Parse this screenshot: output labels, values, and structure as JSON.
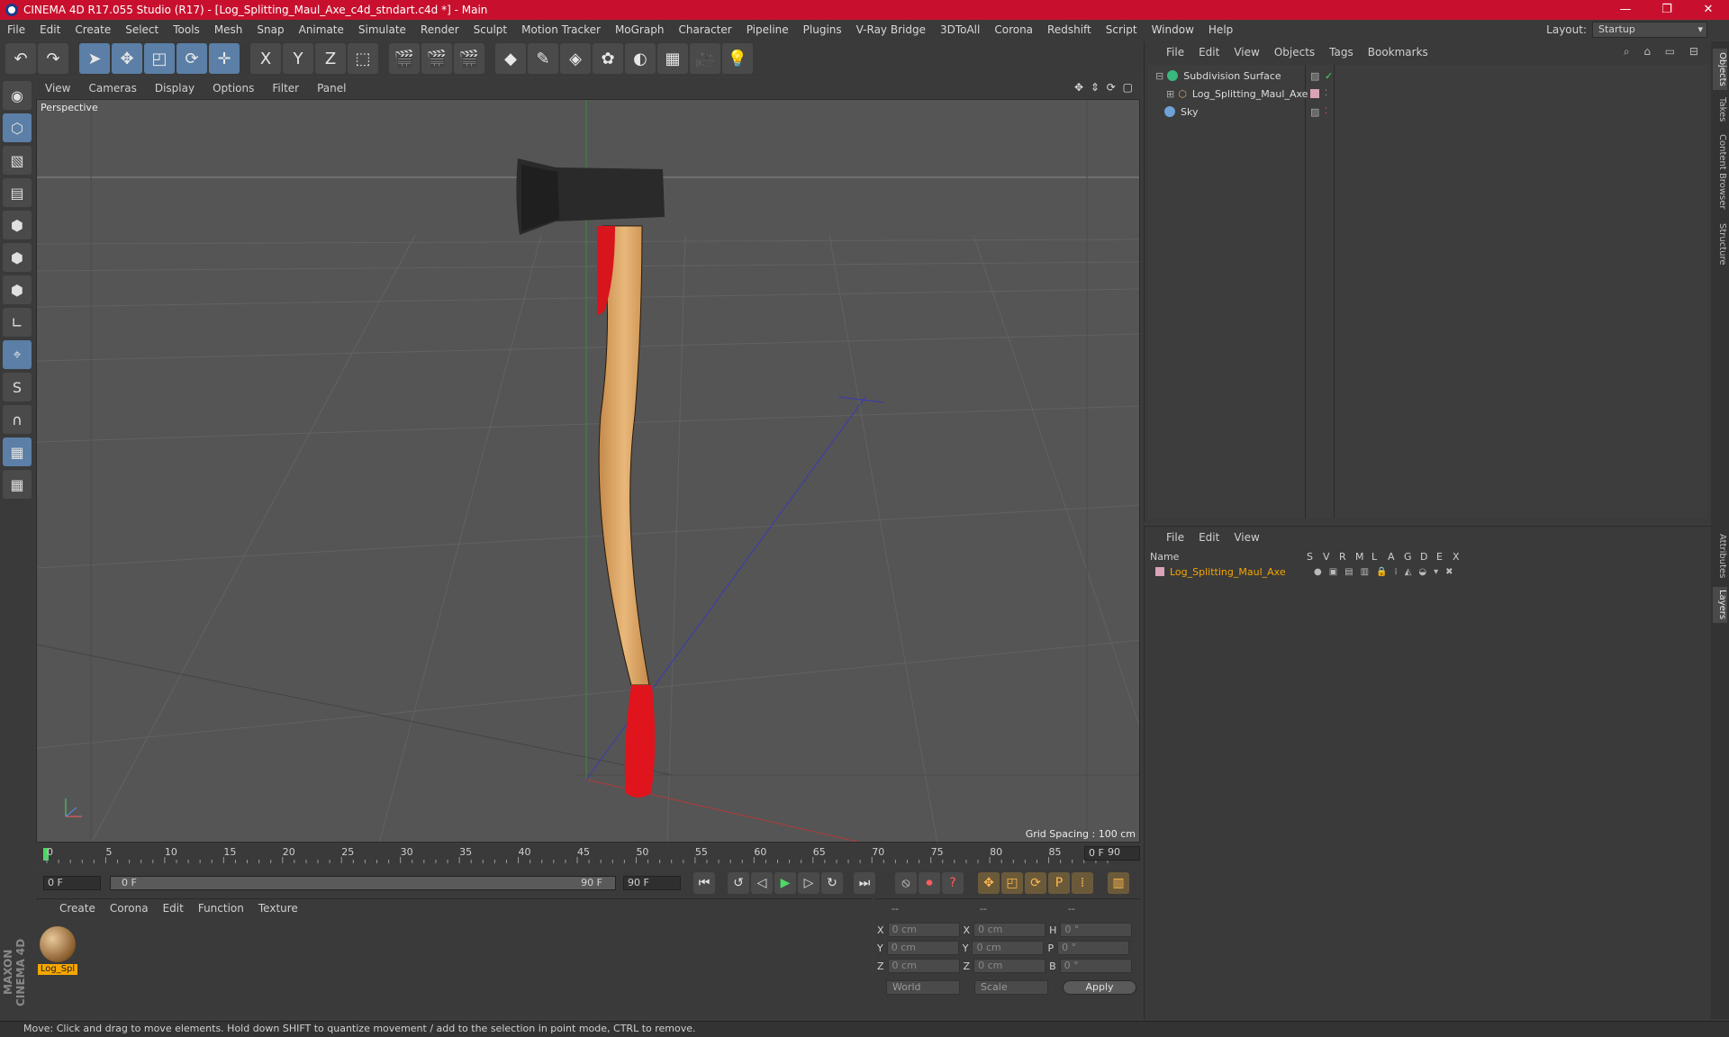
{
  "window": {
    "title": "CINEMA 4D R17.055 Studio (R17) - [Log_Splitting_Maul_Axe_c4d_stndart.c4d *] - Main",
    "controls": [
      "—",
      "❐",
      "✕"
    ]
  },
  "menubar": {
    "items": [
      "File",
      "Edit",
      "Create",
      "Select",
      "Tools",
      "Mesh",
      "Snap",
      "Animate",
      "Simulate",
      "Render",
      "Sculpt",
      "Motion Tracker",
      "MoGraph",
      "Character",
      "Pipeline",
      "Plugins",
      "V-Ray Bridge",
      "3DToAll",
      "Corona",
      "Redshift",
      "Script",
      "Window",
      "Help"
    ],
    "layout_label": "Layout:",
    "layout_value": "Startup"
  },
  "toolbar": {
    "buttons": [
      {
        "name": "undo-icon",
        "glyph": "↶"
      },
      {
        "name": "redo-icon",
        "glyph": "↷"
      },
      {
        "name": "select-arrow-icon",
        "glyph": "➤"
      },
      {
        "name": "move-icon",
        "glyph": "✥"
      },
      {
        "name": "scale-icon",
        "glyph": "◰"
      },
      {
        "name": "rotate-icon",
        "glyph": "⟳"
      },
      {
        "name": "transform-icon",
        "glyph": "✛"
      },
      {
        "name": "x-axis-icon",
        "glyph": "X"
      },
      {
        "name": "y-axis-icon",
        "glyph": "Y"
      },
      {
        "name": "z-axis-icon",
        "glyph": "Z"
      },
      {
        "name": "coordinate-system-icon",
        "glyph": "⬚"
      },
      {
        "name": "render-view-icon",
        "glyph": "🎬"
      },
      {
        "name": "render-picture-viewer-icon",
        "glyph": "🎬"
      },
      {
        "name": "render-settings-icon",
        "glyph": "🎬"
      },
      {
        "name": "cube-icon",
        "glyph": "◆"
      },
      {
        "name": "pen-spline-icon",
        "glyph": "✎"
      },
      {
        "name": "subdivision-icon",
        "glyph": "◈"
      },
      {
        "name": "cloner-icon",
        "glyph": "✿"
      },
      {
        "name": "deformer-icon",
        "glyph": "◐"
      },
      {
        "name": "floor-icon",
        "glyph": "▦"
      },
      {
        "name": "camera-icon",
        "glyph": "🎥"
      },
      {
        "name": "light-icon",
        "glyph": "💡"
      }
    ]
  },
  "left_tools": [
    {
      "name": "model-mode-icon",
      "glyph": "◉"
    },
    {
      "name": "object-mode-icon",
      "glyph": "⬡"
    },
    {
      "name": "texture-mode-icon",
      "glyph": "▧"
    },
    {
      "name": "workplane-icon",
      "glyph": "▤"
    },
    {
      "name": "points-mode-icon",
      "glyph": "⬢"
    },
    {
      "name": "edges-mode-icon",
      "glyph": "⬢"
    },
    {
      "name": "polygons-mode-icon",
      "glyph": "⬢"
    },
    {
      "name": "axis-icon",
      "glyph": "∟"
    },
    {
      "name": "tweak-icon",
      "glyph": "⌖"
    },
    {
      "name": "snap-icon",
      "glyph": "S"
    },
    {
      "name": "magnet-icon",
      "glyph": "∩"
    },
    {
      "name": "lock-grid-icon",
      "glyph": "▦"
    },
    {
      "name": "grid-snap-icon",
      "glyph": "▦"
    }
  ],
  "maxon_logo": "MAXON CINEMA 4D",
  "viewport": {
    "menu": [
      "View",
      "Cameras",
      "Display",
      "Options",
      "Filter",
      "Panel"
    ],
    "nav_icons": "✥ ⇕ ⟳ ▢",
    "label": "Perspective",
    "grid_spacing": "Grid Spacing : 100 cm"
  },
  "timeline": {
    "ticks": [
      "0",
      "5",
      "10",
      "15",
      "20",
      "25",
      "30",
      "35",
      "40",
      "45",
      "50",
      "55",
      "60",
      "65",
      "70",
      "75",
      "80",
      "85",
      "90"
    ],
    "current_frame": "0 F"
  },
  "playbar": {
    "start_field": "0 F",
    "range_start": "0 F",
    "range_end": "90 F",
    "end_field": "90 F"
  },
  "material_panel": {
    "menu": [
      "Create",
      "Corona",
      "Edit",
      "Function",
      "Texture"
    ],
    "material_name": "Log_Spl"
  },
  "coord_panel": {
    "headers": [
      "--",
      "--",
      "--"
    ],
    "rows": [
      {
        "a": "X",
        "av": "0 cm",
        "b": "X",
        "bv": "0 cm",
        "c": "H",
        "cv": "0 °"
      },
      {
        "a": "Y",
        "av": "0 cm",
        "b": "Y",
        "bv": "0 cm",
        "c": "P",
        "cv": "0 °"
      },
      {
        "a": "Z",
        "av": "0 cm",
        "b": "Z",
        "bv": "0 cm",
        "c": "B",
        "cv": "0 °"
      }
    ],
    "world": "World",
    "scale": "Scale",
    "apply": "Apply"
  },
  "object_manager": {
    "menu": [
      "File",
      "Edit",
      "View",
      "Objects",
      "Tags",
      "Bookmarks"
    ],
    "objects": [
      {
        "name": "Subdivision Surface",
        "color": "#3ab77c"
      },
      {
        "name": "Log_Splitting_Maul_Axe",
        "color": "#c8a46a"
      },
      {
        "name": "Sky",
        "color": "#6fa3d8"
      }
    ]
  },
  "layer_manager": {
    "menu": [
      "File",
      "Edit",
      "View"
    ],
    "columns": [
      "Name",
      "S",
      "V",
      "R",
      "M",
      "L",
      "A",
      "G",
      "D",
      "E",
      "X"
    ],
    "layer_name": "Log_Splitting_Maul_Axe",
    "layer_color": "#d9a3b8"
  },
  "right_tabs": [
    "Objects",
    "Takes",
    "Content Browser",
    "Structure",
    "Attributes",
    "Layers"
  ],
  "status": "Move: Click and drag to move elements. Hold down SHIFT to quantize movement / add to the selection in point mode, CTRL to remove."
}
